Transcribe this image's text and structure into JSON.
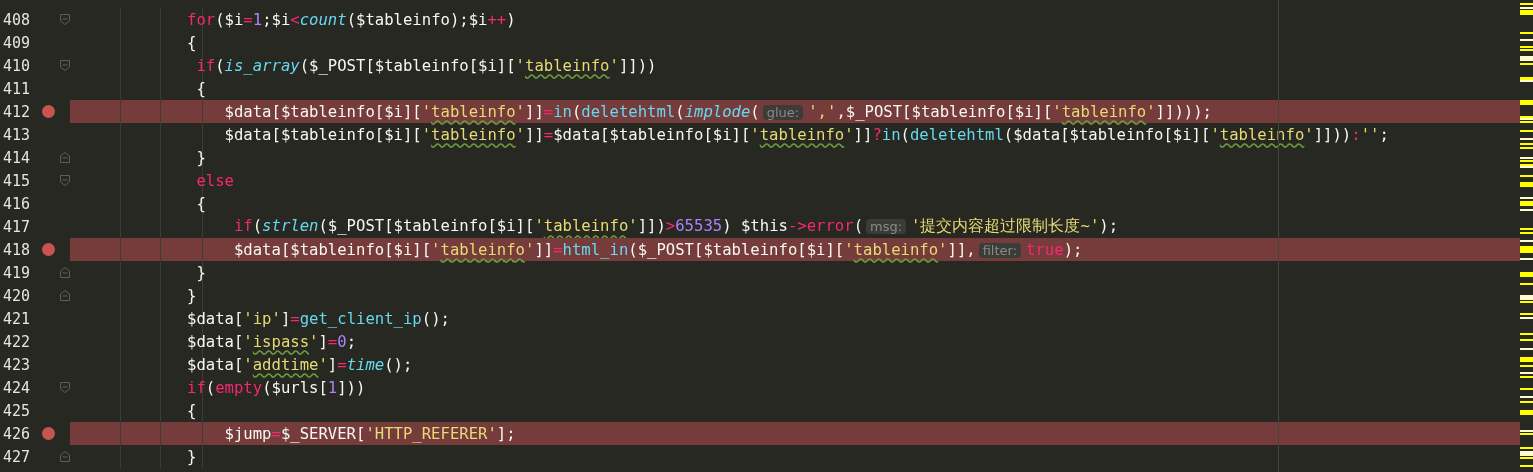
{
  "editor": {
    "lines": [
      {
        "number": "408",
        "breakpoint": false,
        "fold_start": true,
        "fold_end": false,
        "tokens": [
          {
            "kind": "kw",
            "text": "for"
          },
          {
            "kind": "plain",
            "text": "($i"
          },
          {
            "kind": "op",
            "text": "="
          },
          {
            "kind": "num",
            "text": "1"
          },
          {
            "kind": "plain",
            "text": ";$i"
          },
          {
            "kind": "op",
            "text": "<"
          },
          {
            "kind": "fni",
            "text": "count"
          },
          {
            "kind": "plain",
            "text": "($tableinfo);$i"
          },
          {
            "kind": "op",
            "text": "++"
          },
          {
            "kind": "plain",
            "text": ")"
          }
        ]
      },
      {
        "number": "409",
        "breakpoint": false,
        "fold_start": false,
        "fold_end": false,
        "tokens": [
          {
            "kind": "plain",
            "text": "{"
          }
        ]
      },
      {
        "number": "410",
        "breakpoint": false,
        "fold_start": true,
        "fold_end": false,
        "tokens": [
          {
            "kind": "kw",
            "text": " if"
          },
          {
            "kind": "plain",
            "text": "("
          },
          {
            "kind": "fni",
            "text": "is_array"
          },
          {
            "kind": "plain",
            "text": "($_POST[$tableinfo[$i]["
          },
          {
            "kind": "str",
            "text": "'"
          },
          {
            "kind": "strw",
            "text": "tableinfo"
          },
          {
            "kind": "str",
            "text": "'"
          },
          {
            "kind": "plain",
            "text": "]]))"
          }
        ]
      },
      {
        "number": "411",
        "breakpoint": false,
        "fold_start": false,
        "fold_end": false,
        "tokens": [
          {
            "kind": "plain",
            "text": " {"
          }
        ]
      },
      {
        "number": "412",
        "breakpoint": true,
        "fold_start": false,
        "fold_end": false,
        "tokens": [
          {
            "kind": "plain",
            "text": "    $data[$tableinfo[$i]["
          },
          {
            "kind": "str",
            "text": "'"
          },
          {
            "kind": "strw",
            "text": "tableinfo"
          },
          {
            "kind": "str",
            "text": "'"
          },
          {
            "kind": "plain",
            "text": "]]"
          },
          {
            "kind": "op",
            "text": "="
          },
          {
            "kind": "fn",
            "text": "in"
          },
          {
            "kind": "plain",
            "text": "("
          },
          {
            "kind": "fn",
            "text": "deletehtml"
          },
          {
            "kind": "plain",
            "text": "("
          },
          {
            "kind": "fni",
            "text": "implode"
          },
          {
            "kind": "plain",
            "text": "("
          },
          {
            "kind": "hint",
            "text": "glue:"
          },
          {
            "kind": "str",
            "text": "','"
          },
          {
            "kind": "plain",
            "text": ",$_POST[$tableinfo[$i]["
          },
          {
            "kind": "str",
            "text": "'"
          },
          {
            "kind": "strw",
            "text": "tableinfo"
          },
          {
            "kind": "str",
            "text": "'"
          },
          {
            "kind": "plain",
            "text": "]])));"
          }
        ]
      },
      {
        "number": "413",
        "breakpoint": false,
        "fold_start": false,
        "fold_end": false,
        "tokens": [
          {
            "kind": "plain",
            "text": "    $data[$tableinfo[$i]["
          },
          {
            "kind": "str",
            "text": "'"
          },
          {
            "kind": "strw",
            "text": "tableinfo"
          },
          {
            "kind": "str",
            "text": "'"
          },
          {
            "kind": "plain",
            "text": "]]"
          },
          {
            "kind": "op",
            "text": "="
          },
          {
            "kind": "plain",
            "text": "$data[$tableinfo[$i]["
          },
          {
            "kind": "str",
            "text": "'"
          },
          {
            "kind": "strw",
            "text": "tableinfo"
          },
          {
            "kind": "str",
            "text": "'"
          },
          {
            "kind": "plain",
            "text": "]]"
          },
          {
            "kind": "op",
            "text": "?"
          },
          {
            "kind": "fn",
            "text": "in"
          },
          {
            "kind": "plain",
            "text": "("
          },
          {
            "kind": "fn",
            "text": "deletehtml"
          },
          {
            "kind": "plain",
            "text": "($data[$tableinfo[$i]["
          },
          {
            "kind": "str",
            "text": "'"
          },
          {
            "kind": "strw",
            "text": "tableinfo"
          },
          {
            "kind": "str",
            "text": "'"
          },
          {
            "kind": "plain",
            "text": "]]))"
          },
          {
            "kind": "op",
            "text": ":"
          },
          {
            "kind": "str",
            "text": "''"
          },
          {
            "kind": "plain",
            "text": ";"
          }
        ]
      },
      {
        "number": "414",
        "breakpoint": false,
        "fold_start": false,
        "fold_end": true,
        "tokens": [
          {
            "kind": "plain",
            "text": " }"
          }
        ]
      },
      {
        "number": "415",
        "breakpoint": false,
        "fold_start": true,
        "fold_end": false,
        "tokens": [
          {
            "kind": "kw",
            "text": " else"
          }
        ]
      },
      {
        "number": "416",
        "breakpoint": false,
        "fold_start": false,
        "fold_end": false,
        "tokens": [
          {
            "kind": "plain",
            "text": " {"
          }
        ]
      },
      {
        "number": "417",
        "breakpoint": false,
        "fold_start": false,
        "fold_end": false,
        "tokens": [
          {
            "kind": "kw",
            "text": "     if"
          },
          {
            "kind": "plain",
            "text": "("
          },
          {
            "kind": "fni",
            "text": "strlen"
          },
          {
            "kind": "plain",
            "text": "($_POST[$tableinfo[$i]["
          },
          {
            "kind": "str",
            "text": "'"
          },
          {
            "kind": "strw",
            "text": "tableinfo"
          },
          {
            "kind": "str",
            "text": "'"
          },
          {
            "kind": "plain",
            "text": "]])"
          },
          {
            "kind": "op",
            "text": ">"
          },
          {
            "kind": "num",
            "text": "65535"
          },
          {
            "kind": "plain",
            "text": ") $this"
          },
          {
            "kind": "op",
            "text": "->"
          },
          {
            "kind": "kw",
            "text": "error"
          },
          {
            "kind": "plain",
            "text": "("
          },
          {
            "kind": "hint",
            "text": "msg:"
          },
          {
            "kind": "str",
            "text": "'提交内容超过限制长度~'"
          },
          {
            "kind": "plain",
            "text": ");"
          }
        ]
      },
      {
        "number": "418",
        "breakpoint": true,
        "fold_start": false,
        "fold_end": false,
        "tokens": [
          {
            "kind": "plain",
            "text": "     $data[$tableinfo[$i]["
          },
          {
            "kind": "str",
            "text": "'"
          },
          {
            "kind": "strw",
            "text": "tableinfo"
          },
          {
            "kind": "str",
            "text": "'"
          },
          {
            "kind": "plain",
            "text": "]]"
          },
          {
            "kind": "op",
            "text": "="
          },
          {
            "kind": "fn",
            "text": "html_in"
          },
          {
            "kind": "plain",
            "text": "($_POST[$tableinfo[$i]["
          },
          {
            "kind": "str",
            "text": "'"
          },
          {
            "kind": "strw",
            "text": "tableinfo"
          },
          {
            "kind": "str",
            "text": "'"
          },
          {
            "kind": "plain",
            "text": "]],"
          },
          {
            "kind": "hint",
            "text": "filter:"
          },
          {
            "kind": "kw",
            "text": "true"
          },
          {
            "kind": "plain",
            "text": ");"
          }
        ]
      },
      {
        "number": "419",
        "breakpoint": false,
        "fold_start": false,
        "fold_end": true,
        "tokens": [
          {
            "kind": "plain",
            "text": " }"
          }
        ]
      },
      {
        "number": "420",
        "breakpoint": false,
        "fold_start": false,
        "fold_end": true,
        "tokens": [
          {
            "kind": "plain",
            "text": "}"
          }
        ]
      },
      {
        "number": "421",
        "breakpoint": false,
        "fold_start": false,
        "fold_end": false,
        "tokens": [
          {
            "kind": "plain",
            "text": "$data["
          },
          {
            "kind": "str",
            "text": "'ip'"
          },
          {
            "kind": "plain",
            "text": "]"
          },
          {
            "kind": "op",
            "text": "="
          },
          {
            "kind": "fn",
            "text": "get_client_ip"
          },
          {
            "kind": "plain",
            "text": "();"
          }
        ]
      },
      {
        "number": "422",
        "breakpoint": false,
        "fold_start": false,
        "fold_end": false,
        "tokens": [
          {
            "kind": "plain",
            "text": "$data["
          },
          {
            "kind": "str",
            "text": "'"
          },
          {
            "kind": "strw",
            "text": "ispass"
          },
          {
            "kind": "str",
            "text": "'"
          },
          {
            "kind": "plain",
            "text": "]"
          },
          {
            "kind": "op",
            "text": "="
          },
          {
            "kind": "num",
            "text": "0"
          },
          {
            "kind": "plain",
            "text": ";"
          }
        ]
      },
      {
        "number": "423",
        "breakpoint": false,
        "fold_start": false,
        "fold_end": false,
        "tokens": [
          {
            "kind": "plain",
            "text": "$data["
          },
          {
            "kind": "str",
            "text": "'"
          },
          {
            "kind": "strw",
            "text": "addtime"
          },
          {
            "kind": "str",
            "text": "'"
          },
          {
            "kind": "plain",
            "text": "]"
          },
          {
            "kind": "op",
            "text": "="
          },
          {
            "kind": "fni",
            "text": "time"
          },
          {
            "kind": "plain",
            "text": "();"
          }
        ]
      },
      {
        "number": "424",
        "breakpoint": false,
        "fold_start": true,
        "fold_end": false,
        "tokens": [
          {
            "kind": "kw",
            "text": "if"
          },
          {
            "kind": "plain",
            "text": "("
          },
          {
            "kind": "kw",
            "text": "empty"
          },
          {
            "kind": "plain",
            "text": "($urls["
          },
          {
            "kind": "num",
            "text": "1"
          },
          {
            "kind": "plain",
            "text": "]))"
          }
        ]
      },
      {
        "number": "425",
        "breakpoint": false,
        "fold_start": false,
        "fold_end": false,
        "tokens": [
          {
            "kind": "plain",
            "text": "{"
          }
        ]
      },
      {
        "number": "426",
        "breakpoint": true,
        "fold_start": false,
        "fold_end": false,
        "tokens": [
          {
            "kind": "plain",
            "text": "    $jump"
          },
          {
            "kind": "op",
            "text": "="
          },
          {
            "kind": "plain",
            "text": "$_SERVER["
          },
          {
            "kind": "str",
            "text": "'HTTP_REFERER'"
          },
          {
            "kind": "plain",
            "text": "];"
          }
        ]
      },
      {
        "number": "427",
        "breakpoint": false,
        "fold_start": false,
        "fold_end": true,
        "tokens": [
          {
            "kind": "plain",
            "text": "}"
          }
        ]
      }
    ]
  }
}
